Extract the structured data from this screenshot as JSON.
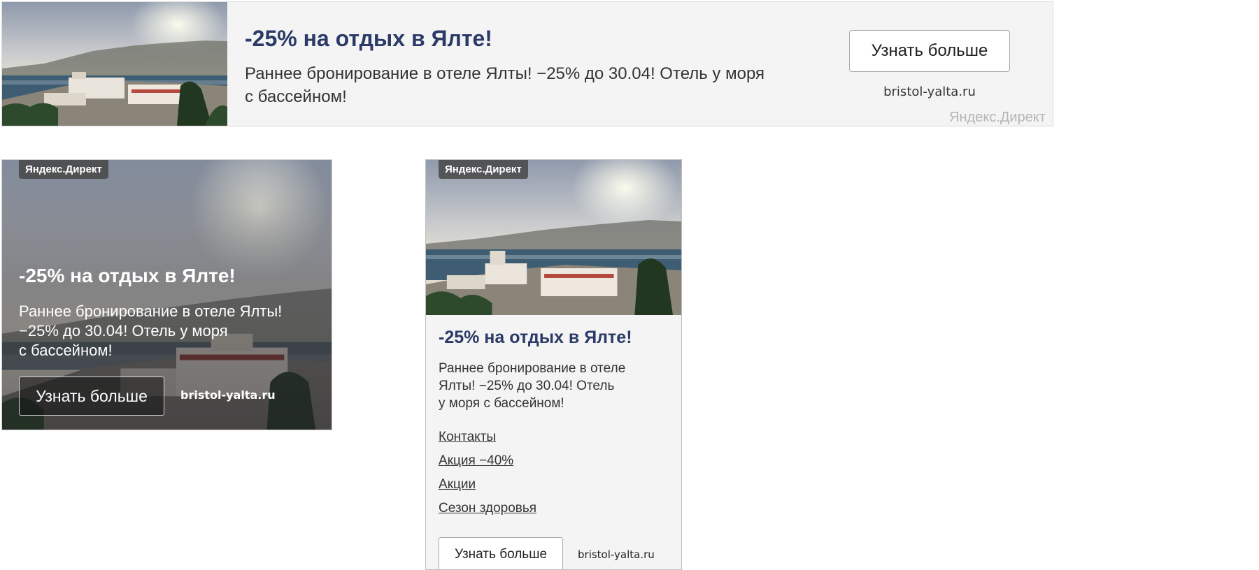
{
  "ad": {
    "title": "-25% на отдых в Ялте!",
    "text": "Раннее бронирование в отеле Ялты! −25% до 30.04! Отель у моря с бассейном!",
    "button_label": "Узнать больше",
    "domain": "bristol-yalta.ru",
    "network_label": "Яндекс.Директ",
    "photo_icon": "hotel-seaside-photo"
  },
  "overlay_text_lines": [
    "Раннее бронирование в отеле Ялты!",
    "−25% до 30.04! Отель у моря",
    "с бассейном!"
  ],
  "vertical_text_lines": [
    "Раннее бронирование в отеле",
    "Ялты! −25% до 30.04! Отель",
    "у моря с бассейном!"
  ],
  "wide_text_lines": [
    "Раннее бронирование в отеле Ялты! −25% до 30.04! Отель у моря",
    "с бассейном!"
  ],
  "sitelinks": [
    {
      "label": "Контакты"
    },
    {
      "label": "Акция −40%"
    },
    {
      "label": "Акции"
    },
    {
      "label": "Сезон здоровья"
    }
  ],
  "colors": {
    "title": "#2b3a67",
    "card_bg": "#f4f4f4",
    "direct_label": "#b5b5b5"
  }
}
